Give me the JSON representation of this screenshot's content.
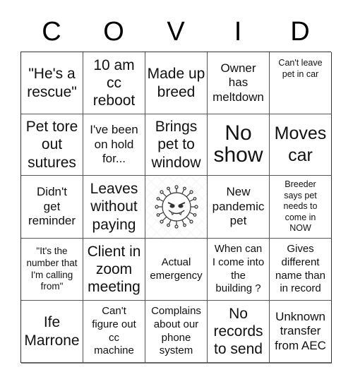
{
  "header": {
    "letters": [
      "C",
      "O",
      "V",
      "I",
      "D"
    ]
  },
  "board": {
    "cells": [
      {
        "text": "\"He's a rescue\"",
        "size": "m"
      },
      {
        "text": "10 am cc reboot",
        "size": "m"
      },
      {
        "text": "Made up breed",
        "size": "m"
      },
      {
        "text": "Owner has meltdown",
        "size": "s"
      },
      {
        "text": "Can't leave pet in car",
        "size": "xxs",
        "valign": "top"
      },
      {
        "text": "Pet tore out sutures",
        "size": "m"
      },
      {
        "text": "I've been on hold for...",
        "size": "s"
      },
      {
        "text": "Brings pet to window",
        "size": "m"
      },
      {
        "text": "No show",
        "size": "l"
      },
      {
        "text": "Moves car",
        "size": "l-moves"
      },
      {
        "text": "Didn't get reminder",
        "size": "s"
      },
      {
        "text": "Leaves without paying",
        "size": "m"
      },
      {
        "text": "",
        "free": true,
        "icon": "virus-icon"
      },
      {
        "text": "New pandemic pet",
        "size": "s"
      },
      {
        "text": "Breeder says pet needs to come in NOW",
        "size": "xxs"
      },
      {
        "text": "\"It's the number that I'm calling from\"",
        "size": "xs-small"
      },
      {
        "text": "Client in zoom meeting",
        "size": "m"
      },
      {
        "text": "Actual emergency",
        "size": "xs"
      },
      {
        "text": "When can I come into the building ?",
        "size": "xs"
      },
      {
        "text": "Gives different name than in record",
        "size": "xs"
      },
      {
        "text": "Ife Marrone",
        "size": "m"
      },
      {
        "text": "Can't figure out cc machine",
        "size": "xs"
      },
      {
        "text": "Complains about our phone system",
        "size": "xs"
      },
      {
        "text": "No records to send",
        "size": "m"
      },
      {
        "text": "Unknown transfer from AEC",
        "size": "s"
      }
    ]
  }
}
